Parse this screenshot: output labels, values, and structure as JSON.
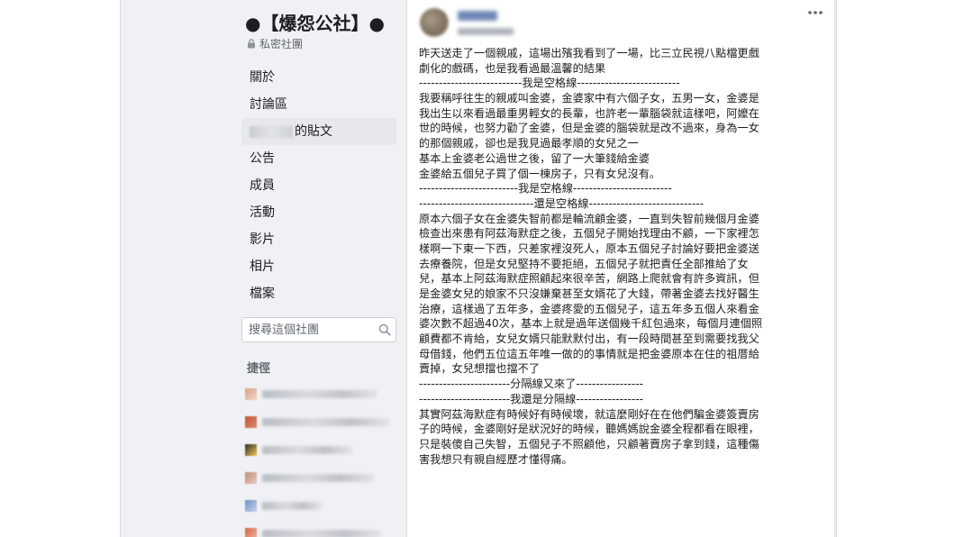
{
  "group": {
    "title": "●【爆怨公社】●",
    "privacy": "私密社團"
  },
  "nav": {
    "items": [
      "關於",
      "討論區",
      "的貼文",
      "公告",
      "成員",
      "活動",
      "影片",
      "相片",
      "檔案"
    ]
  },
  "search": {
    "placeholder": "搜尋這個社團"
  },
  "shortcuts": {
    "title": "捷徑"
  },
  "icons": {
    "privacy": "lock-icon",
    "search": "search-icon",
    "post_menu": "more-horizontal-icon"
  },
  "colors": {
    "page_bg": "#f0f1f4",
    "active_nav_bg": "#e6e8ec",
    "text": "#1c1e21",
    "secondary_text": "#606770"
  },
  "post": {
    "lines": [
      "昨天送走了一個親戚，這場出殯我看到了一場，比三立民視八點檔更戲",
      "劇化的戲碼，也是我看過最溫馨的結果",
      "--------------------------我是空格線--------------------------",
      "我要稱呼往生的親戚叫金婆，金婆家中有六個子女，五男一女，金婆是",
      "我出生以來看過最重男輕女的長輩，也許老一輩腦袋就這樣吧，阿嬤在",
      "世的時候，也努力勸了金婆，但是金婆的腦袋就是改不過來，身為一女",
      "的那個親戚，卻也是我見過最孝順的女兒之一",
      "基本上金婆老公過世之後，留了一大筆錢給金婆",
      "金婆給五個兒子買了個一棟房子，只有女兒沒有。",
      "-------------------------我是空格線-------------------------",
      "-----------------------------還是空格線-----------------------------",
      "原本六個子女在金婆失智前都是輪流顧金婆，一直到失智前幾個月金婆",
      "檢查出來患有阿茲海默症之後，五個兒子開始找理由不顧，一下家裡怎",
      "樣啊一下東一下西，只差家裡沒死人，原本五個兒子討論好要把金婆送",
      "去療養院，但是女兒堅持不要拒絕，五個兒子就把責任全部推給了女",
      "兒，基本上阿茲海默症照顧起來很辛苦，網路上爬就會有許多資訊，但",
      "是金婆女兒的娘家不只沒嫌棄甚至女婿花了大錢，帶著金婆去找好醫生",
      "治療，這樣過了五年多，金婆疼愛的五個兒子，這五年多五個人來看金",
      "婆次數不超過40次，基本上就是過年送個幾千紅包過來，每個月連個照",
      "顧費都不肯給，女兒女婿只能默默付出，有一段時間甚至到需要找我父",
      "母借錢，他們五位這五年唯一做的的事情就是把金婆原本在住的祖厝給",
      "賣掉，女兒想擋也擋不了",
      "-----------------------分隔線又來了-----------------",
      "-----------------------我還是分隔線-----------------",
      "其實阿茲海默症有時候好有時候壞，就這麼剛好在在他們騙金婆簽賣房",
      "子的時候，金婆剛好是狀況好的時候，聽媽媽說金婆全程都看在眼裡，",
      "只是裝傻自己失智，五個兒子不照顧他，只顧著賣房子拿到錢，這種傷",
      "害我想只有親自經歷才懂得痛。"
    ]
  }
}
